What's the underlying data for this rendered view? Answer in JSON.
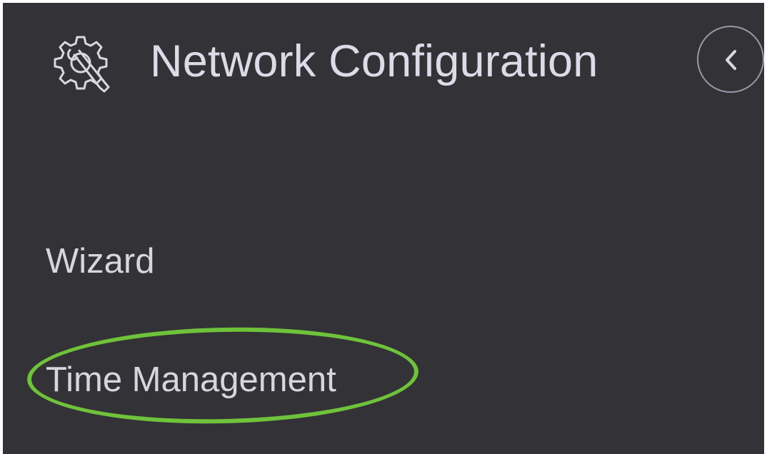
{
  "nav": {
    "title": "Network Configuration",
    "icon": "gear-wrench-icon",
    "collapse_icon": "chevron-left-icon",
    "items": [
      {
        "label": "Wizard"
      },
      {
        "label": "Time Management",
        "highlighted": true
      }
    ]
  },
  "colors": {
    "background": "#323237",
    "text": "#d6d6de",
    "highlight": "#6ec33a"
  }
}
